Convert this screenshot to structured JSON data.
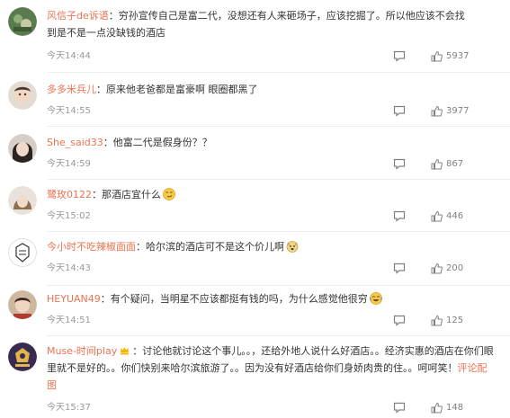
{
  "colors": {
    "accent": "#eb7350",
    "meta": "#999999",
    "text": "#333333"
  },
  "comments": [
    {
      "username": "风信子de诉语",
      "text_lines": [
        "：穷孙宣传自己是富二代，没想还有人来砸场子，应该挖掘了。所以他应该不会找",
        "到是不是一点没缺钱的酒店"
      ],
      "time": "今天14:44",
      "likes": "5937"
    },
    {
      "username": "多多米兵儿",
      "text_lines": [
        "：原来他老爸都是富豪啊 眼圈都黑了"
      ],
      "time": "今天14:55",
      "likes": "3977"
    },
    {
      "username": "She_said33",
      "text_lines": [
        "：他富二代是假身份？？"
      ],
      "time": "今天14:59",
      "likes": "867"
    },
    {
      "username": "鹭玫0122",
      "text_lines": [
        "：那酒店宜什么"
      ],
      "time": "今天15:02",
      "likes": "446",
      "emoji": "smirk-emoji"
    },
    {
      "username": "今小时不吃辣椒面面",
      "text_lines": [
        "：哈尔滨的酒店可不是这个价儿啊"
      ],
      "time": "今天14:43",
      "likes": "200",
      "emoji": "doge-emoji"
    },
    {
      "username": "HEYUAN49",
      "text_lines": [
        "：有个疑问，当明星不应该都挺有钱的吗，为什么感觉他很穷"
      ],
      "time": "今天14:51",
      "likes": "125",
      "emoji": "laugh-cry-emoji"
    },
    {
      "username": "Muse-时间play",
      "text_lines": [
        "：讨论他就讨论这个事儿。。，还给外地人说什么好酒店。。经济实惠的酒店在你们眼",
        "里就不是好的。。你们快别来哈尔滨旅游了。。因为没有好酒店给你们身娇肉贵的住。。呵呵笑！",
        "图"
      ],
      "time": "今天15:37",
      "likes": "148",
      "vip": true,
      "link_text": "评论配"
    }
  ]
}
